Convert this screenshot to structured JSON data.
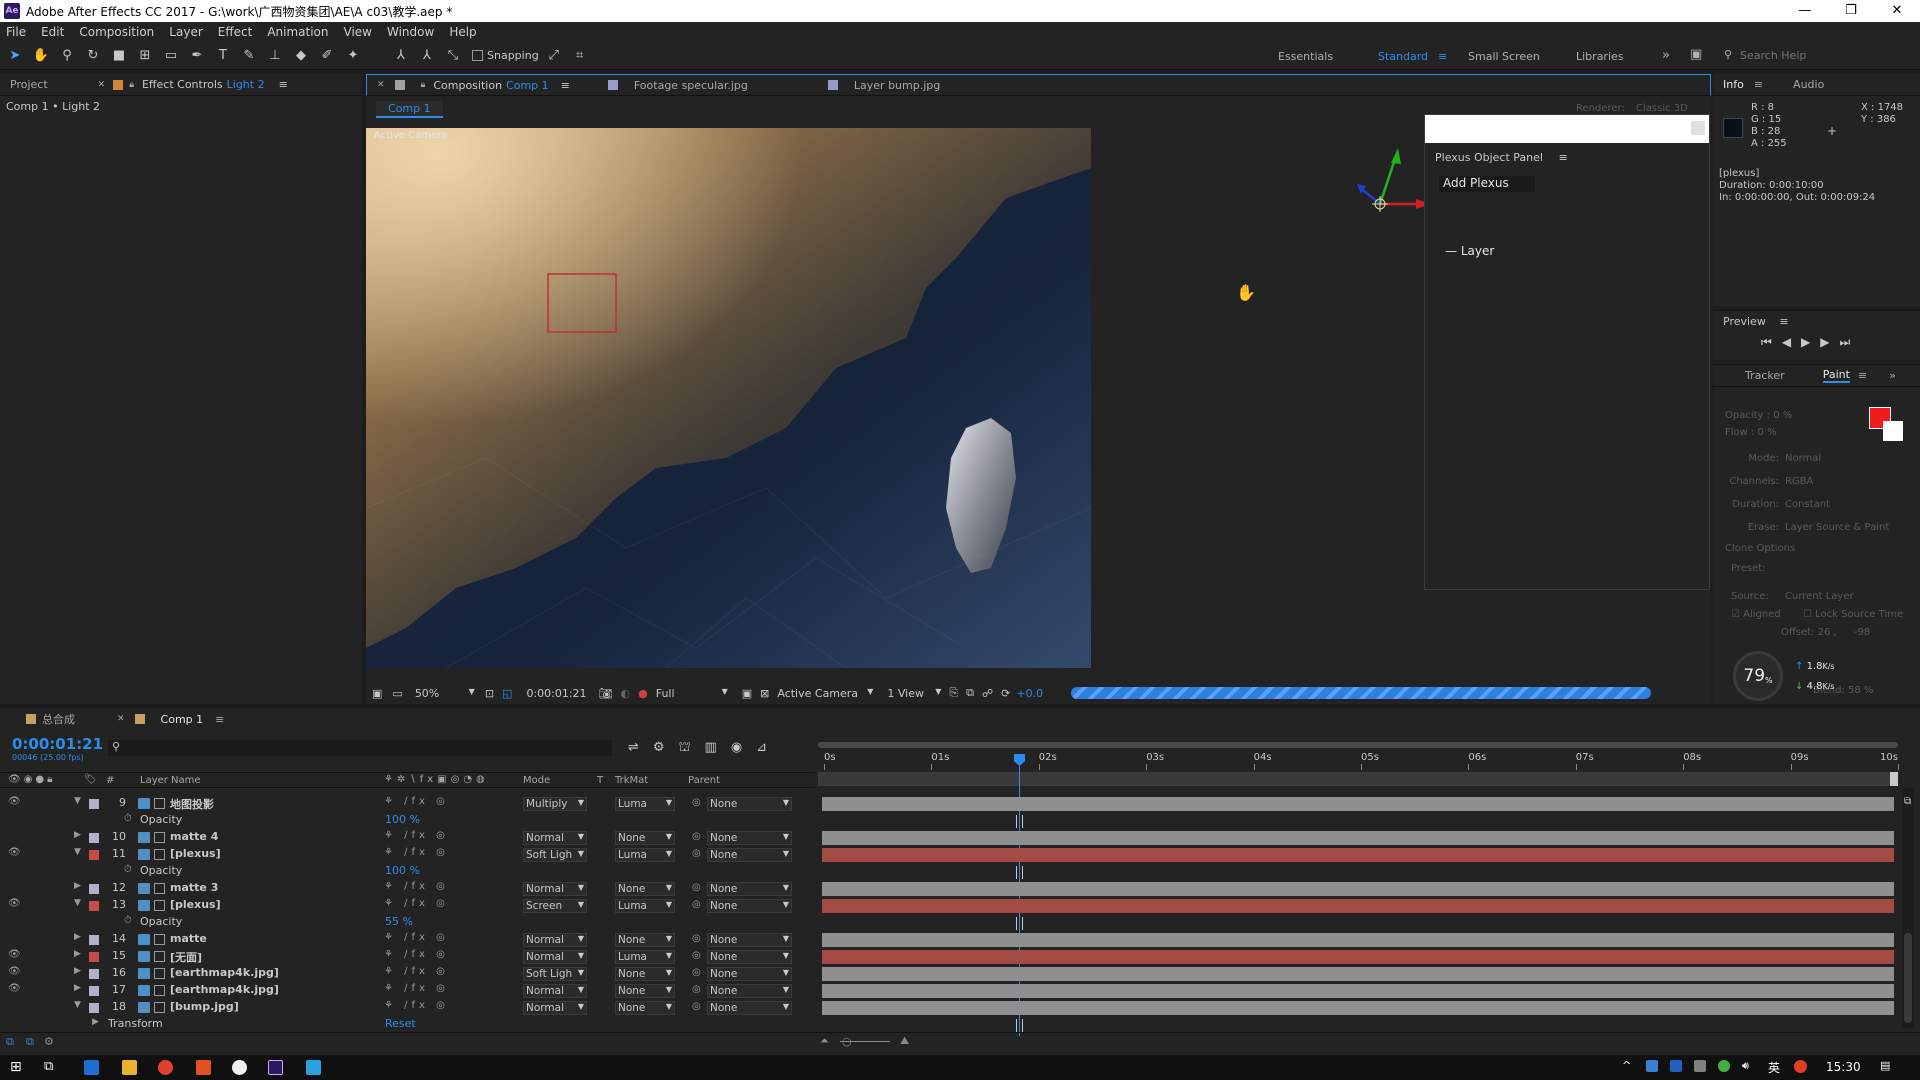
{
  "window": {
    "title": "Adobe After Effects CC 2017 - G:\\work\\广西物资集团\\AE\\A c03\\教学.aep *",
    "logo": "Ae",
    "controls": [
      "—",
      "❐",
      "✕"
    ]
  },
  "menu": [
    "File",
    "Edit",
    "Composition",
    "Layer",
    "Effect",
    "Animation",
    "View",
    "Window",
    "Help"
  ],
  "toolbar": {
    "snapping_label": "Snapping",
    "workspaces": [
      "Essentials",
      "Standard",
      "Small Screen",
      "Libraries"
    ],
    "active_workspace": "Standard",
    "search_placeholder": "Search Help"
  },
  "left_panel": {
    "tabs": [
      "Project",
      "Effect Controls"
    ],
    "effect_controls_target": "Light 2",
    "breadcrumb": "Comp 1 • Light 2"
  },
  "viewer": {
    "tabs": [
      {
        "label": "Composition",
        "target": "Comp 1"
      },
      {
        "label": "Footage specular.jpg"
      },
      {
        "label": "Layer bump.jpg"
      }
    ],
    "comp_button": "Comp 1",
    "renderer_label": "Renderer:",
    "renderer_value": "Classic 3D",
    "camera_label": "Active Camera",
    "footer": {
      "zoom": "50%",
      "timecode": "0:00:01:21",
      "resolution": "Full",
      "camera": "Active Camera",
      "views": "1 View",
      "exposure": "+0.0"
    }
  },
  "plexus_panel": {
    "title": "Plexus Object Panel",
    "add_button": "Add Plexus",
    "layer_item": "Layer"
  },
  "info_panel": {
    "tabs": [
      "Info",
      "Audio"
    ],
    "r": "R : 8",
    "g": "G : 15",
    "b": "B : 28",
    "a": "A : 255",
    "x": "X : 1748",
    "y": "Y : 386",
    "layer_name": "[plexus]",
    "duration": "Duration: 0:00:10:00",
    "in_out": "In: 0:00:00:00, Out: 0:00:09:24"
  },
  "preview_panel": {
    "title": "Preview"
  },
  "paint_panel": {
    "tabs": [
      "Tracker",
      "Paint"
    ],
    "opacity": "Opacity : 0 %",
    "flow": "Flow : 0 %",
    "mode_label": "Mode:",
    "mode_value": "Normal",
    "channels_label": "Channels:",
    "channels_value": "RGBA",
    "duration_label": "Duration:",
    "duration_value": "Constant",
    "erase_label": "Erase:",
    "erase_value": "Layer Source & Paint",
    "clone_options": "Clone Options",
    "preset_label": "Preset:",
    "source_label": "Source:",
    "source_value": "Current Layer",
    "aligned": "Aligned",
    "lock_source": "Lock Source Time",
    "offset": "Offset: 26 ,",
    "offset_y": "-98",
    "blend": "Blend: 58 %",
    "fg_color": "#ee1c1c",
    "bg_color": "#ffffff"
  },
  "perf_widget": {
    "percent": "79",
    "unit": "%",
    "up": "1.8",
    "down": "4.8",
    "rate_unit": "K/s"
  },
  "timeline": {
    "tabs": [
      "总合成",
      "Comp 1"
    ],
    "timecode": "0:00:01:21",
    "frame_info": "00046 (25.00 fps)",
    "columns": [
      "#",
      "Layer Name",
      "Mode",
      "T",
      "TrkMat",
      "Parent"
    ],
    "ruler": [
      "0s",
      "01s",
      "02s",
      "03s",
      "04s",
      "05s",
      "06s",
      "07s",
      "08s",
      "09s",
      "10s"
    ],
    "rows": [
      {
        "kind": "layer",
        "num": "9",
        "name": "地图投影",
        "label": "#b0b0c8",
        "mode": "Multiply",
        "trk": "Luma",
        "parent": "None",
        "bar": "gray",
        "eye": "true"
      },
      {
        "kind": "prop",
        "name": "Opacity",
        "value": "100 %"
      },
      {
        "kind": "layer",
        "num": "10",
        "name": "matte 4",
        "label": "#b0b0c8",
        "mode": "Normal",
        "trk": "None",
        "parent": "None",
        "bar": "gray",
        "eye": "false"
      },
      {
        "kind": "layer",
        "num": "11",
        "name": "[plexus]",
        "label": "#c44c46",
        "mode": "Soft Ligh",
        "trk": "Luma",
        "parent": "None",
        "bar": "red",
        "eye": "true"
      },
      {
        "kind": "prop",
        "name": "Opacity",
        "value": "100 %"
      },
      {
        "kind": "layer",
        "num": "12",
        "name": "matte 3",
        "label": "#b0b0c8",
        "mode": "Normal",
        "trk": "None",
        "parent": "None",
        "bar": "gray",
        "eye": "false"
      },
      {
        "kind": "layer",
        "num": "13",
        "name": "[plexus]",
        "label": "#c44c46",
        "mode": "Screen",
        "trk": "Luma",
        "parent": "None",
        "bar": "red",
        "eye": "true"
      },
      {
        "kind": "prop",
        "name": "Opacity",
        "value": "55 %"
      },
      {
        "kind": "layer",
        "num": "14",
        "name": "matte",
        "label": "#b0b0c8",
        "mode": "Normal",
        "trk": "None",
        "parent": "None",
        "bar": "gray",
        "eye": "false"
      },
      {
        "kind": "layer",
        "num": "15",
        "name": "[无面]",
        "label": "#c44c46",
        "mode": "Normal",
        "trk": "Luma",
        "parent": "None",
        "bar": "red",
        "eye": "true"
      },
      {
        "kind": "layer",
        "num": "16",
        "name": "[earthmap4k.jpg]",
        "label": "#b0b0c8",
        "mode": "Soft Ligh",
        "trk": "None",
        "parent": "None",
        "bar": "gray",
        "eye": "true"
      },
      {
        "kind": "layer",
        "num": "17",
        "name": "[earthmap4k.jpg]",
        "label": "#b0b0c8",
        "mode": "Normal",
        "trk": "None",
        "parent": "None",
        "bar": "gray",
        "eye": "true"
      },
      {
        "kind": "layer",
        "num": "18",
        "name": "[bump.jpg]",
        "label": "#b0b0c8",
        "mode": "Normal",
        "trk": "None",
        "parent": "None",
        "bar": "gray",
        "eye": "false"
      },
      {
        "kind": "prop",
        "name": "Transform",
        "value": "Reset"
      }
    ]
  },
  "taskbar": {
    "time": "15:30",
    "ime": "英"
  }
}
